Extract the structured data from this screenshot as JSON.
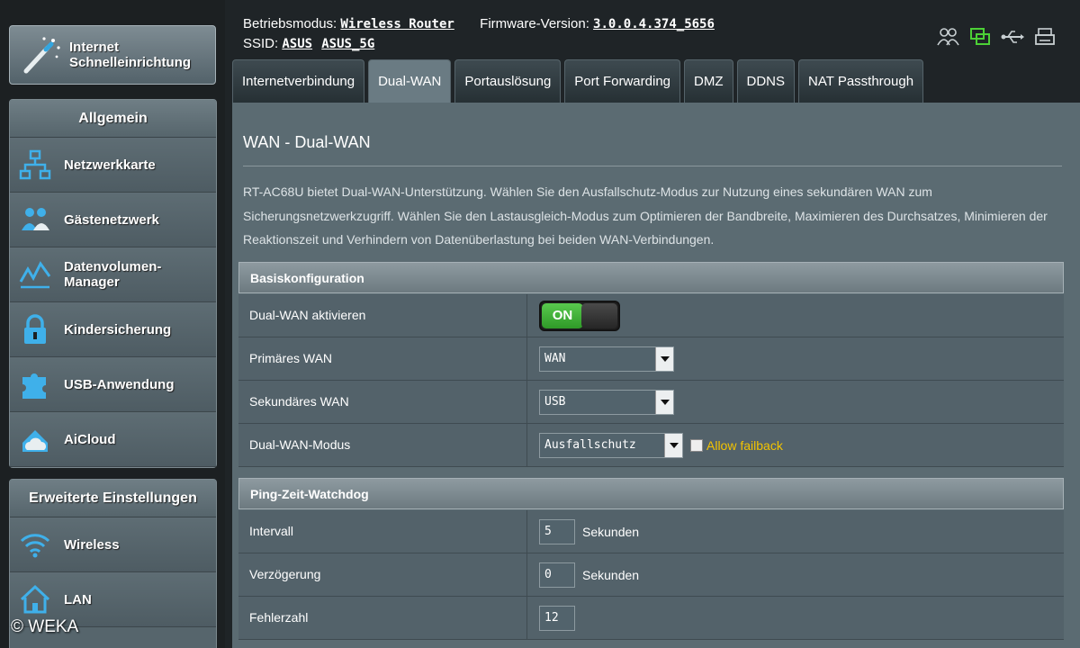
{
  "sidebar": {
    "quick_setup_label_line1": "Internet",
    "quick_setup_label_line2": "Schnelleinrichtung",
    "general_header": "Allgemein",
    "general_items": [
      {
        "label": "Netzwerkkarte",
        "icon": "network-map-icon"
      },
      {
        "label": "Gästenetzwerk",
        "icon": "guest-network-icon"
      },
      {
        "label_line1": "Datenvolumen-",
        "label_line2": "Manager",
        "icon": "traffic-manager-icon"
      },
      {
        "label": "Kindersicherung",
        "icon": "lock-icon"
      },
      {
        "label": "USB-Anwendung",
        "icon": "puzzle-icon"
      },
      {
        "label": "AiCloud",
        "icon": "cloud-icon"
      }
    ],
    "advanced_header": "Erweiterte Einstellungen",
    "advanced_items": [
      {
        "label": "Wireless",
        "icon": "wifi-icon"
      },
      {
        "label": "LAN",
        "icon": "home-icon"
      }
    ]
  },
  "header": {
    "mode_label": "Betriebsmodus:",
    "mode_value": "Wireless Router",
    "firmware_label": "Firmware-Version:",
    "firmware_value": "3.0.0.4.374_5656",
    "ssid_label": "SSID:",
    "ssid_1": "ASUS",
    "ssid_2": "ASUS_5G"
  },
  "tabs": [
    {
      "label": "Internetverbindung",
      "active": false
    },
    {
      "label": "Dual-WAN",
      "active": true
    },
    {
      "label": "Portauslösung",
      "active": false
    },
    {
      "label": "Port Forwarding",
      "active": false
    },
    {
      "label": "DMZ",
      "active": false
    },
    {
      "label": "DDNS",
      "active": false
    },
    {
      "label": "NAT Passthrough",
      "active": false
    }
  ],
  "main": {
    "title": "WAN - Dual-WAN",
    "description": "RT-AC68U bietet Dual-WAN-Unterstützung. Wählen Sie den Ausfallschutz-Modus zur Nutzung eines sekundären WAN zum Sicherungsnetzwerkzugriff. Wählen Sie den Lastausgleich-Modus zum Optimieren der Bandbreite, Maximieren des Durchsatzes, Minimieren der Reaktionszeit und Verhindern von Datenüberlastung bei beiden WAN-Verbindungen.",
    "basic": {
      "header": "Basiskonfiguration",
      "enable_label": "Dual-WAN aktivieren",
      "toggle_text": "ON",
      "primary_label": "Primäres WAN",
      "primary_value": "WAN",
      "secondary_label": "Sekundäres WAN",
      "secondary_value": "USB",
      "mode_label": "Dual-WAN-Modus",
      "mode_value": "Ausfallschutz",
      "allow_failback": "Allow failback"
    },
    "ping": {
      "header": "Ping-Zeit-Watchdog",
      "interval_label": "Intervall",
      "interval_value": "5",
      "interval_unit": "Sekunden",
      "delay_label": "Verzögerung",
      "delay_value": "0",
      "delay_unit": "Sekunden",
      "failcount_label": "Fehlerzahl",
      "failcount_value": "12"
    }
  },
  "watermark": "© WEKA"
}
